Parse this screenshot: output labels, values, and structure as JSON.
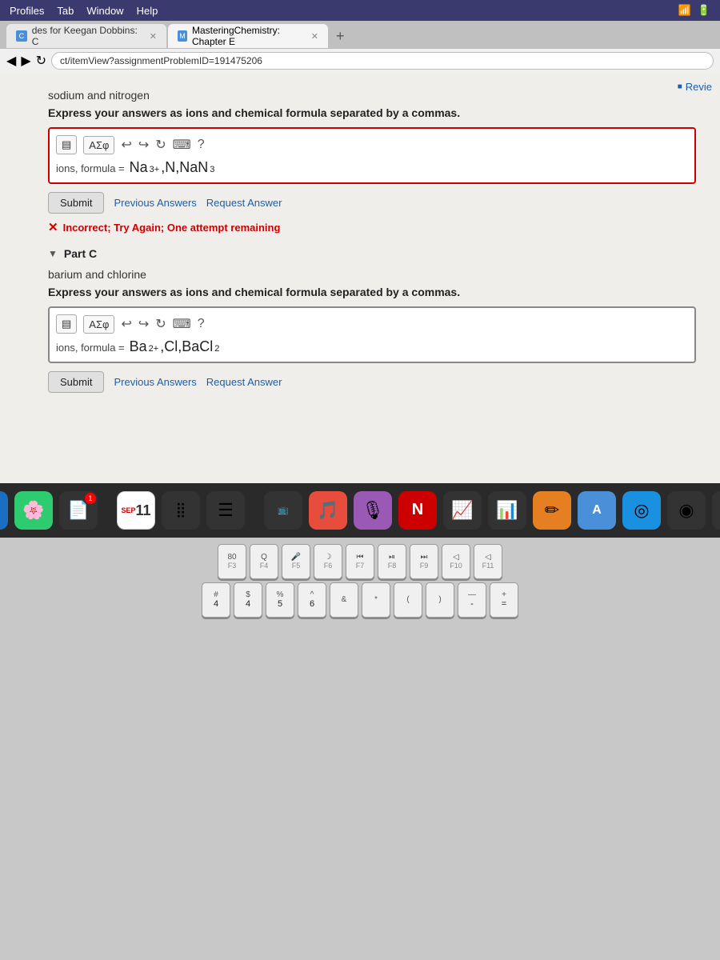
{
  "menubar": {
    "items": [
      "Profiles",
      "Tab",
      "Window",
      "Help"
    ]
  },
  "tabs": [
    {
      "id": "tab1",
      "label": "des for Keegan Dobbins: C",
      "favicon": "C",
      "active": false
    },
    {
      "id": "tab2",
      "label": "MasteringChemistry: Chapter E",
      "favicon": "M",
      "active": true
    }
  ],
  "tab_new_label": "+",
  "address_bar": {
    "url": "ct/itemView?assignmentProblemID=191475206"
  },
  "revise_label": "Revie",
  "partB": {
    "section": "sodium and nitrogen",
    "instruction": "Express your answers as ions and chemical formula separated by a commas.",
    "toolbar": {
      "format_btn": "▤",
      "greek_btn": "ΑΣφ",
      "undo_icon": "↩",
      "redo_icon": "↪",
      "reset_icon": "↻",
      "keyboard_icon": "⌨",
      "help_icon": "?"
    },
    "formula_label": "ions, formula =",
    "formula_value": "Na³⁺,N,NaN₃",
    "formula_display": "Na",
    "formula_sup": "3+",
    "formula_rest": ",N,NaN",
    "formula_sub": "3",
    "submit_label": "Submit",
    "prev_answers_label": "Previous Answers",
    "request_answer_label": "Request Answer",
    "error_text": "Incorrect; Try Again; One attempt remaining"
  },
  "partC": {
    "arrow": "▼",
    "label": "Part C",
    "section": "barium and chlorine",
    "instruction": "Express your answers as ions and chemical formula separated by a commas.",
    "toolbar": {
      "format_btn": "▤",
      "greek_btn": "ΑΣφ",
      "undo_icon": "↩",
      "redo_icon": "↪",
      "reset_icon": "↻",
      "keyboard_icon": "⌨",
      "help_icon": "?"
    },
    "formula_label": "ions, formula =",
    "formula_display": "Ba",
    "formula_sup": "2+",
    "formula_rest": ",Cl,BaCl",
    "formula_sub": "2",
    "submit_label": "Submit",
    "prev_answers_label": "Previous Answers",
    "request_answer_label": "Request Answer"
  },
  "dock": {
    "items": [
      {
        "id": "finder",
        "icon": "🌀",
        "color": "blue"
      },
      {
        "id": "photos",
        "icon": "🌸",
        "color": "green"
      },
      {
        "id": "files",
        "icon": "📄",
        "color": "dark",
        "badge": "1"
      },
      {
        "id": "sep1",
        "type": "sep"
      },
      {
        "id": "cal",
        "icon": "11",
        "color": "lightgray",
        "label": "SEP\n11"
      },
      {
        "id": "apps",
        "icon": "⣿",
        "color": "dark"
      },
      {
        "id": "reminders",
        "icon": "☰",
        "color": "dark"
      },
      {
        "id": "sep2",
        "type": "sep"
      },
      {
        "id": "appletv",
        "icon": "📺",
        "color": "dark",
        "sublabel": "tv"
      },
      {
        "id": "music",
        "icon": "🎵",
        "color": "red"
      },
      {
        "id": "podcast",
        "icon": "🎙",
        "color": "purple"
      },
      {
        "id": "news",
        "icon": "N",
        "color": "dark"
      },
      {
        "id": "stocks",
        "icon": "T",
        "color": "dark"
      },
      {
        "id": "chart",
        "icon": "📊",
        "color": "dark"
      },
      {
        "id": "notes",
        "icon": "✏",
        "color": "orange"
      },
      {
        "id": "translate",
        "icon": "A",
        "color": "blue"
      },
      {
        "id": "safari",
        "icon": "◎",
        "color": "blue"
      },
      {
        "id": "chrome",
        "icon": "◉",
        "color": "dark"
      },
      {
        "id": "display",
        "icon": "🖥",
        "color": "dark"
      }
    ]
  },
  "keyboard": {
    "fn_row": [
      {
        "label": "80",
        "sub": "F3"
      },
      {
        "label": "Q",
        "sub": "F4"
      },
      {
        "label": "🎤",
        "sub": "F5"
      },
      {
        "label": "C",
        "sub": "F6"
      },
      {
        "label": "⏮",
        "sub": "F7"
      },
      {
        "label": "⏯",
        "sub": "F8"
      },
      {
        "label": "⏭",
        "sub": "F9"
      },
      {
        "label": "◁",
        "sub": "F10"
      },
      {
        "label": "◁",
        "sub": "F11"
      }
    ],
    "num_row": [
      {
        "top": "#",
        "label": "4"
      },
      {
        "top": "$",
        "label": "4"
      },
      {
        "top": "%",
        "label": "5"
      },
      {
        "top": "^",
        "label": "6"
      },
      {
        "top": "&",
        "label": ""
      },
      {
        "top": "*",
        "label": ""
      },
      {
        "top": "(",
        "label": ""
      },
      {
        "top": ")",
        "label": ""
      },
      {
        "top": "-",
        "label": ""
      },
      {
        "top": "+",
        "label": ""
      }
    ]
  }
}
